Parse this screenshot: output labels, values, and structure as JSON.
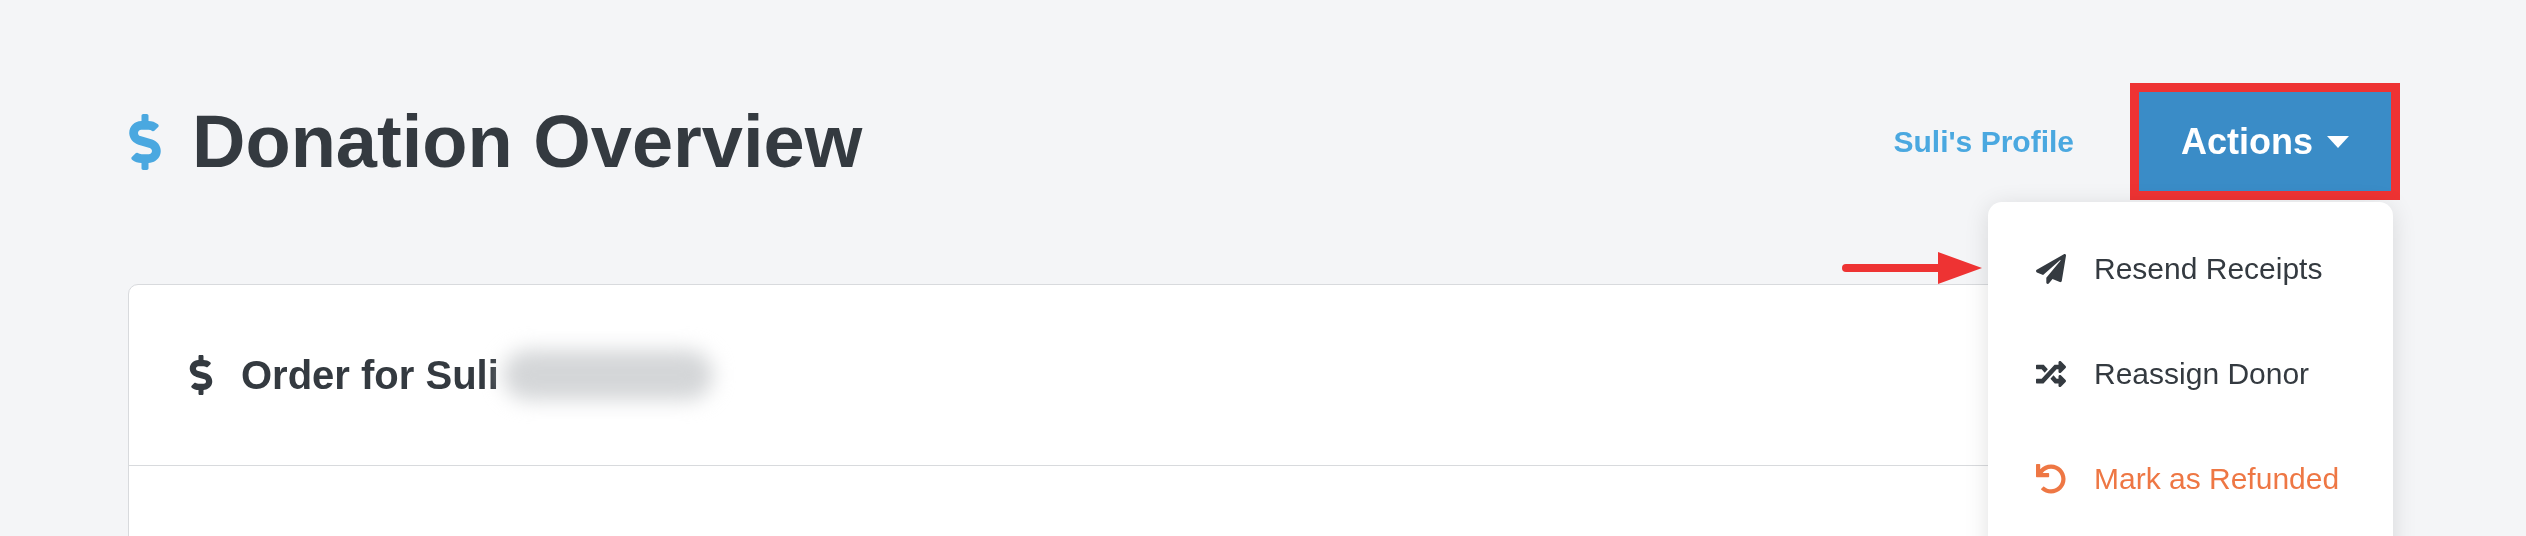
{
  "page_title": "Donation Overview",
  "profile_link": "Suli's Profile",
  "actions_button": {
    "label": "Actions",
    "highlighted": true
  },
  "menu": {
    "pointer_arrow": true,
    "items": [
      {
        "kind": "send",
        "label": "Resend Receipts",
        "danger": false
      },
      {
        "kind": "shuffle",
        "label": "Reassign Donor",
        "danger": false
      },
      {
        "kind": "undo",
        "label": "Mark as Refunded",
        "danger": true
      }
    ]
  },
  "card": {
    "title": "Order for Suli",
    "redacted": true
  }
}
